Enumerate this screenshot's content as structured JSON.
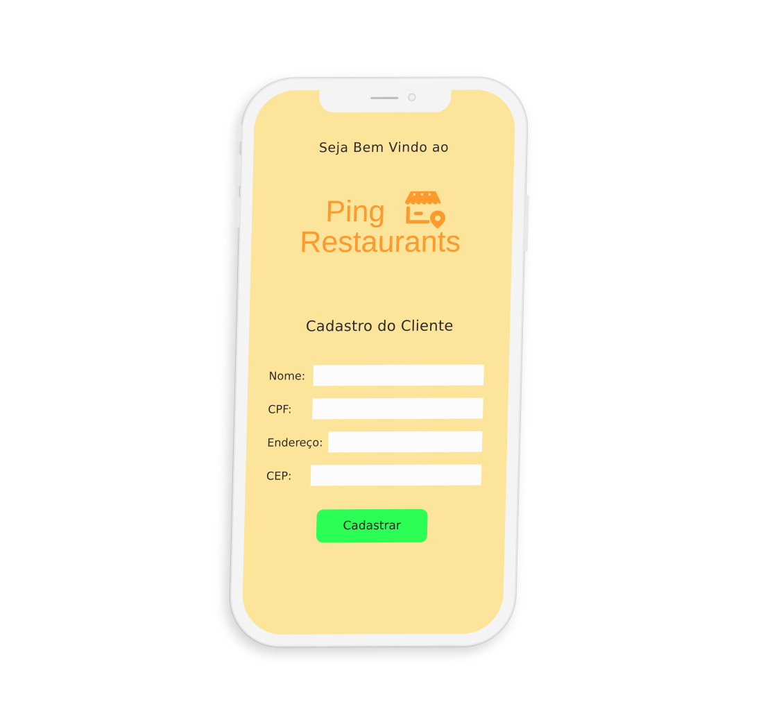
{
  "app": {
    "welcome_text": "Seja Bem Vindo ao",
    "logo_line1": "Ping",
    "logo_line2": "Restaurants",
    "form_title": "Cadastro do Cliente"
  },
  "form": {
    "fields": [
      {
        "label": "Nome:",
        "value": "",
        "placeholder": ""
      },
      {
        "label": "CPF:",
        "value": "",
        "placeholder": ""
      },
      {
        "label": "Endereço:",
        "value": "",
        "placeholder": ""
      },
      {
        "label": "CEP:",
        "value": "",
        "placeholder": ""
      }
    ],
    "submit_label": "Cadastrar"
  },
  "colors": {
    "screen_background": "#fce59a",
    "brand_orange": "#fc9a2e",
    "button_green": "#2bff55",
    "field_background": "#fcfcfc",
    "text": "#2b2b2b"
  },
  "icons": {
    "logo": "storefront-location-pin-icon"
  }
}
